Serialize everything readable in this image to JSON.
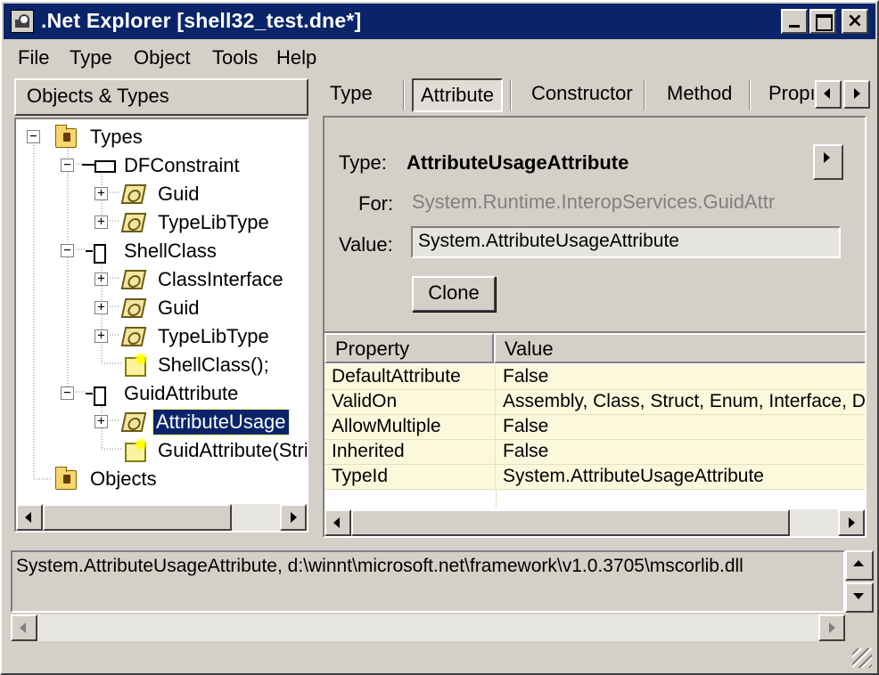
{
  "window": {
    "title": ".Net Explorer [shell32_test.dne*]",
    "controls": {
      "minimize": "",
      "maximize": "",
      "close": "×"
    }
  },
  "menu": [
    {
      "label": "File"
    },
    {
      "label": "Type"
    },
    {
      "label": "Object"
    },
    {
      "label": "Tools"
    },
    {
      "label": "Help"
    }
  ],
  "left_pane": {
    "header": "Objects & Types",
    "tree": [
      {
        "label": "Types",
        "icon": "folder-icon",
        "expander": "−",
        "selected": false
      },
      {
        "label": "DFConstraint",
        "icon": "field-icon",
        "expander": "−",
        "selected": false
      },
      {
        "label": "Guid",
        "icon": "attribute-icon",
        "expander": "+",
        "selected": false
      },
      {
        "label": "TypeLibType",
        "icon": "attribute-icon",
        "expander": "+",
        "selected": false
      },
      {
        "label": "ShellClass",
        "icon": "class-icon",
        "expander": "−",
        "selected": false
      },
      {
        "label": "ClassInterface",
        "icon": "attribute-icon",
        "expander": "+",
        "selected": false
      },
      {
        "label": "Guid",
        "icon": "attribute-icon",
        "expander": "+",
        "selected": false
      },
      {
        "label": "TypeLibType",
        "icon": "attribute-icon",
        "expander": "+",
        "selected": false
      },
      {
        "label": "ShellClass();",
        "icon": "constructor-icon",
        "expander": "",
        "selected": false
      },
      {
        "label": "GuidAttribute",
        "icon": "class-icon",
        "expander": "−",
        "selected": false
      },
      {
        "label": "AttributeUsage",
        "icon": "attribute-icon",
        "expander": "+",
        "selected": true
      },
      {
        "label": "GuidAttribute(Strir",
        "icon": "constructor-icon",
        "expander": "",
        "selected": false
      },
      {
        "label": "Objects",
        "icon": "folder-icon",
        "expander": "",
        "selected": false
      }
    ]
  },
  "tabs": [
    {
      "label": "Type",
      "active": false
    },
    {
      "label": "Attribute",
      "active": true
    },
    {
      "label": "Constructor",
      "active": false
    },
    {
      "label": "Method",
      "active": false
    },
    {
      "label": "Propı",
      "active": false
    }
  ],
  "detail": {
    "type_label": "Type:",
    "type_value": "AttributeUsageAttribute",
    "for_label": "For:",
    "for_value": "System.Runtime.InteropServices.GuidAttr",
    "value_label": "Value:",
    "value_value": "System.AttributeUsageAttribute",
    "clone_button": "Clone"
  },
  "grid": {
    "columns": [
      "Property",
      "Value"
    ],
    "rows": [
      {
        "property": "DefaultAttribute",
        "value": "False"
      },
      {
        "property": "ValidOn",
        "value": "Assembly, Class, Struct, Enum, Interface, D"
      },
      {
        "property": "AllowMultiple",
        "value": "False"
      },
      {
        "property": "Inherited",
        "value": "False"
      },
      {
        "property": "TypeId",
        "value": "System.AttributeUsageAttribute"
      }
    ]
  },
  "status": {
    "text": "System.AttributeUsageAttribute, d:\\winnt\\microsoft.net\\framework\\v1.0.3705\\mscorlib.dll"
  },
  "colors": {
    "titlebar": "#0a246a",
    "face": "#d4d0c8",
    "grid_cell": "#fbf8dc",
    "selection": "#0a246a"
  }
}
